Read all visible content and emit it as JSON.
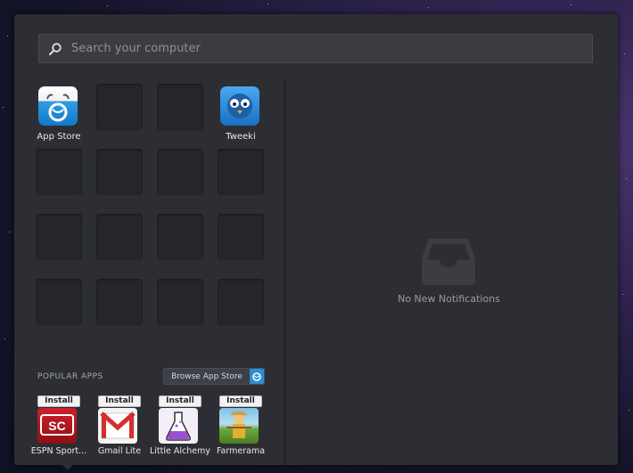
{
  "search": {
    "placeholder": "Search your computer"
  },
  "apps": [
    {
      "label": "App Store",
      "icon": "app-store-icon"
    },
    {
      "label": "Tweeki",
      "icon": "tweeki-icon"
    }
  ],
  "popular": {
    "title": "POPULAR APPS",
    "browse_label": "Browse App Store",
    "install_label": "Install",
    "items": [
      {
        "label": "ESPN Sport...",
        "icon": "espn-sportscenter-icon"
      },
      {
        "label": "Gmail Lite",
        "icon": "gmail-icon"
      },
      {
        "label": "Little Alchemy",
        "icon": "little-alchemy-icon"
      },
      {
        "label": "Farmerama",
        "icon": "farmerama-icon"
      }
    ]
  },
  "notifications": {
    "empty_text": "No New Notifications"
  },
  "colors": {
    "panel": "#2c2e33",
    "accent": "#2a8fd4"
  }
}
